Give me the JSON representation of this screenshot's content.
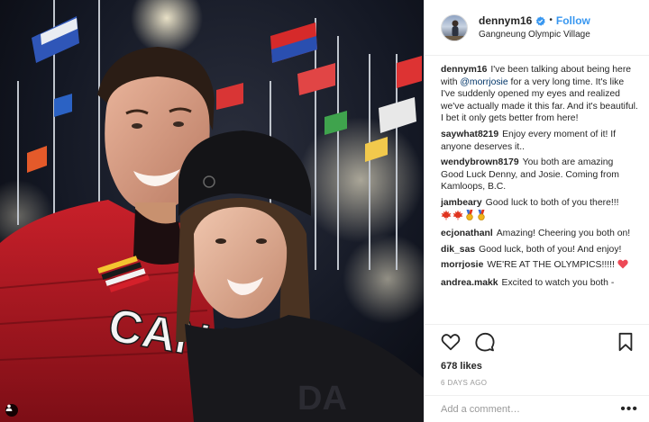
{
  "post": {
    "username": "dennym16",
    "follow_label": "Follow",
    "separator": "•",
    "location": "Gangneung Olympic Village"
  },
  "photo": {
    "jersey_text": "CANA",
    "icon": "user-tag-icon"
  },
  "comments": [
    {
      "user": "dennym16",
      "text_before": "I've been talking about being here with ",
      "mention": "@morrjosie",
      "text_after": " for a very long time. It's like I've suddenly opened my eyes and realized we've actually made it this far. And it's beautiful.",
      "text_line2": "I bet it only gets better from here!"
    },
    {
      "user": "saywhat8219",
      "text": "Enjoy every moment of it! If anyone deserves it.."
    },
    {
      "user": "wendybrown8179",
      "text": "You both are amazing Good Luck Denny, and Josie. Coming from Kamloops, B.C."
    },
    {
      "user": "jambeary",
      "text": "Good luck to both of you there!!!"
    },
    {
      "user": "ecjonathanl",
      "text": "Amazing! Cheering you both on!"
    },
    {
      "user": "dik_sas",
      "text": "Good luck, both of you! And enjoy!"
    },
    {
      "user": "morrjosie",
      "text": "WE'RE AT THE OLYMPICS!!!!!"
    },
    {
      "user": "andrea.makk",
      "text": "Excited to watch you both -"
    }
  ],
  "emojis": {
    "jambeary_icons": [
      "maple-leaf-icon",
      "maple-leaf-icon",
      "medal-icon",
      "medal-icon"
    ],
    "morrjosie_icon": "heart-icon"
  },
  "actions": {
    "icons": [
      "heart-outline-icon",
      "comment-icon",
      "bookmark-icon"
    ],
    "likes": "678 likes",
    "timestamp": "6 DAYS AGO"
  },
  "add_comment": {
    "placeholder": "Add a comment…",
    "more_label": "•••"
  },
  "colors": {
    "link": "#3897f0",
    "verified": "#3897f0",
    "mention": "#003569",
    "heart": "#ed4956",
    "maple": "#e0341e",
    "text": "#262626",
    "muted": "#999999"
  }
}
